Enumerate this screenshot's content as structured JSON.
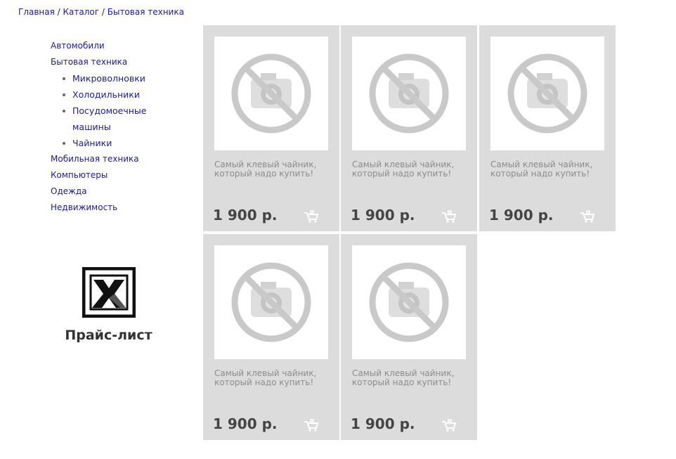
{
  "breadcrumb": [
    "Главная",
    "Каталог",
    "Бытовая техника"
  ],
  "breadcrumb_sep": " / ",
  "sidebar": {
    "items_top": [
      "Автомобили",
      "Бытовая техника"
    ],
    "subitems": [
      "Микроволновки",
      "Холодильники",
      "Посудомоечные машины",
      "Чайники"
    ],
    "items_bottom": [
      "Мобильная техника",
      "Компьютеры",
      "Одежда",
      "Недвижимость"
    ]
  },
  "price_list": {
    "label": "Прайс-лист",
    "icon": "excel-icon"
  },
  "products": [
    {
      "description": "Самый клевый чайник, который надо купить!",
      "price": "1 900 р."
    },
    {
      "description": "Самый клевый чайник, который надо купить!",
      "price": "1 900 р."
    },
    {
      "description": "Самый клевый чайник, который надо купить!",
      "price": "1 900 р."
    },
    {
      "description": "Самый клевый чайник, который надо купить!",
      "price": "1 900 р."
    },
    {
      "description": "Самый клевый чайник, который надо купить!",
      "price": "1 900 р."
    }
  ],
  "colors": {
    "link": "#1a1aa8",
    "card_bg": "#dcdcdc",
    "price": "#444444",
    "desc": "#8c8c8c"
  }
}
